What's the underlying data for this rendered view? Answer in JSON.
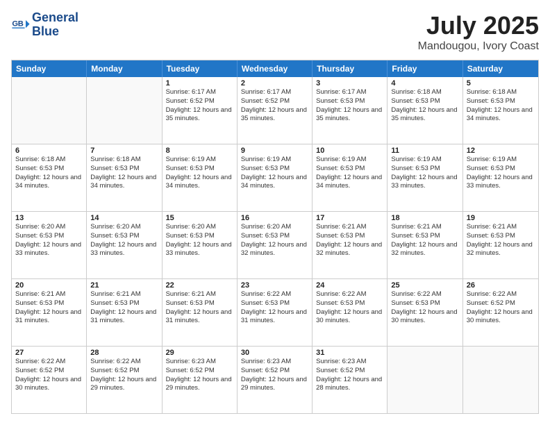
{
  "header": {
    "logo_line1": "General",
    "logo_line2": "Blue",
    "title": "July 2025",
    "subtitle": "Mandougou, Ivory Coast"
  },
  "days_of_week": [
    "Sunday",
    "Monday",
    "Tuesday",
    "Wednesday",
    "Thursday",
    "Friday",
    "Saturday"
  ],
  "weeks": [
    [
      {
        "num": "",
        "sunrise": "",
        "sunset": "",
        "daylight": ""
      },
      {
        "num": "",
        "sunrise": "",
        "sunset": "",
        "daylight": ""
      },
      {
        "num": "1",
        "sunrise": "Sunrise: 6:17 AM",
        "sunset": "Sunset: 6:52 PM",
        "daylight": "Daylight: 12 hours and 35 minutes."
      },
      {
        "num": "2",
        "sunrise": "Sunrise: 6:17 AM",
        "sunset": "Sunset: 6:52 PM",
        "daylight": "Daylight: 12 hours and 35 minutes."
      },
      {
        "num": "3",
        "sunrise": "Sunrise: 6:17 AM",
        "sunset": "Sunset: 6:53 PM",
        "daylight": "Daylight: 12 hours and 35 minutes."
      },
      {
        "num": "4",
        "sunrise": "Sunrise: 6:18 AM",
        "sunset": "Sunset: 6:53 PM",
        "daylight": "Daylight: 12 hours and 35 minutes."
      },
      {
        "num": "5",
        "sunrise": "Sunrise: 6:18 AM",
        "sunset": "Sunset: 6:53 PM",
        "daylight": "Daylight: 12 hours and 34 minutes."
      }
    ],
    [
      {
        "num": "6",
        "sunrise": "Sunrise: 6:18 AM",
        "sunset": "Sunset: 6:53 PM",
        "daylight": "Daylight: 12 hours and 34 minutes."
      },
      {
        "num": "7",
        "sunrise": "Sunrise: 6:18 AM",
        "sunset": "Sunset: 6:53 PM",
        "daylight": "Daylight: 12 hours and 34 minutes."
      },
      {
        "num": "8",
        "sunrise": "Sunrise: 6:19 AM",
        "sunset": "Sunset: 6:53 PM",
        "daylight": "Daylight: 12 hours and 34 minutes."
      },
      {
        "num": "9",
        "sunrise": "Sunrise: 6:19 AM",
        "sunset": "Sunset: 6:53 PM",
        "daylight": "Daylight: 12 hours and 34 minutes."
      },
      {
        "num": "10",
        "sunrise": "Sunrise: 6:19 AM",
        "sunset": "Sunset: 6:53 PM",
        "daylight": "Daylight: 12 hours and 34 minutes."
      },
      {
        "num": "11",
        "sunrise": "Sunrise: 6:19 AM",
        "sunset": "Sunset: 6:53 PM",
        "daylight": "Daylight: 12 hours and 33 minutes."
      },
      {
        "num": "12",
        "sunrise": "Sunrise: 6:19 AM",
        "sunset": "Sunset: 6:53 PM",
        "daylight": "Daylight: 12 hours and 33 minutes."
      }
    ],
    [
      {
        "num": "13",
        "sunrise": "Sunrise: 6:20 AM",
        "sunset": "Sunset: 6:53 PM",
        "daylight": "Daylight: 12 hours and 33 minutes."
      },
      {
        "num": "14",
        "sunrise": "Sunrise: 6:20 AM",
        "sunset": "Sunset: 6:53 PM",
        "daylight": "Daylight: 12 hours and 33 minutes."
      },
      {
        "num": "15",
        "sunrise": "Sunrise: 6:20 AM",
        "sunset": "Sunset: 6:53 PM",
        "daylight": "Daylight: 12 hours and 33 minutes."
      },
      {
        "num": "16",
        "sunrise": "Sunrise: 6:20 AM",
        "sunset": "Sunset: 6:53 PM",
        "daylight": "Daylight: 12 hours and 32 minutes."
      },
      {
        "num": "17",
        "sunrise": "Sunrise: 6:21 AM",
        "sunset": "Sunset: 6:53 PM",
        "daylight": "Daylight: 12 hours and 32 minutes."
      },
      {
        "num": "18",
        "sunrise": "Sunrise: 6:21 AM",
        "sunset": "Sunset: 6:53 PM",
        "daylight": "Daylight: 12 hours and 32 minutes."
      },
      {
        "num": "19",
        "sunrise": "Sunrise: 6:21 AM",
        "sunset": "Sunset: 6:53 PM",
        "daylight": "Daylight: 12 hours and 32 minutes."
      }
    ],
    [
      {
        "num": "20",
        "sunrise": "Sunrise: 6:21 AM",
        "sunset": "Sunset: 6:53 PM",
        "daylight": "Daylight: 12 hours and 31 minutes."
      },
      {
        "num": "21",
        "sunrise": "Sunrise: 6:21 AM",
        "sunset": "Sunset: 6:53 PM",
        "daylight": "Daylight: 12 hours and 31 minutes."
      },
      {
        "num": "22",
        "sunrise": "Sunrise: 6:21 AM",
        "sunset": "Sunset: 6:53 PM",
        "daylight": "Daylight: 12 hours and 31 minutes."
      },
      {
        "num": "23",
        "sunrise": "Sunrise: 6:22 AM",
        "sunset": "Sunset: 6:53 PM",
        "daylight": "Daylight: 12 hours and 31 minutes."
      },
      {
        "num": "24",
        "sunrise": "Sunrise: 6:22 AM",
        "sunset": "Sunset: 6:53 PM",
        "daylight": "Daylight: 12 hours and 30 minutes."
      },
      {
        "num": "25",
        "sunrise": "Sunrise: 6:22 AM",
        "sunset": "Sunset: 6:53 PM",
        "daylight": "Daylight: 12 hours and 30 minutes."
      },
      {
        "num": "26",
        "sunrise": "Sunrise: 6:22 AM",
        "sunset": "Sunset: 6:52 PM",
        "daylight": "Daylight: 12 hours and 30 minutes."
      }
    ],
    [
      {
        "num": "27",
        "sunrise": "Sunrise: 6:22 AM",
        "sunset": "Sunset: 6:52 PM",
        "daylight": "Daylight: 12 hours and 30 minutes."
      },
      {
        "num": "28",
        "sunrise": "Sunrise: 6:22 AM",
        "sunset": "Sunset: 6:52 PM",
        "daylight": "Daylight: 12 hours and 29 minutes."
      },
      {
        "num": "29",
        "sunrise": "Sunrise: 6:23 AM",
        "sunset": "Sunset: 6:52 PM",
        "daylight": "Daylight: 12 hours and 29 minutes."
      },
      {
        "num": "30",
        "sunrise": "Sunrise: 6:23 AM",
        "sunset": "Sunset: 6:52 PM",
        "daylight": "Daylight: 12 hours and 29 minutes."
      },
      {
        "num": "31",
        "sunrise": "Sunrise: 6:23 AM",
        "sunset": "Sunset: 6:52 PM",
        "daylight": "Daylight: 12 hours and 28 minutes."
      },
      {
        "num": "",
        "sunrise": "",
        "sunset": "",
        "daylight": ""
      },
      {
        "num": "",
        "sunrise": "",
        "sunset": "",
        "daylight": ""
      }
    ]
  ]
}
